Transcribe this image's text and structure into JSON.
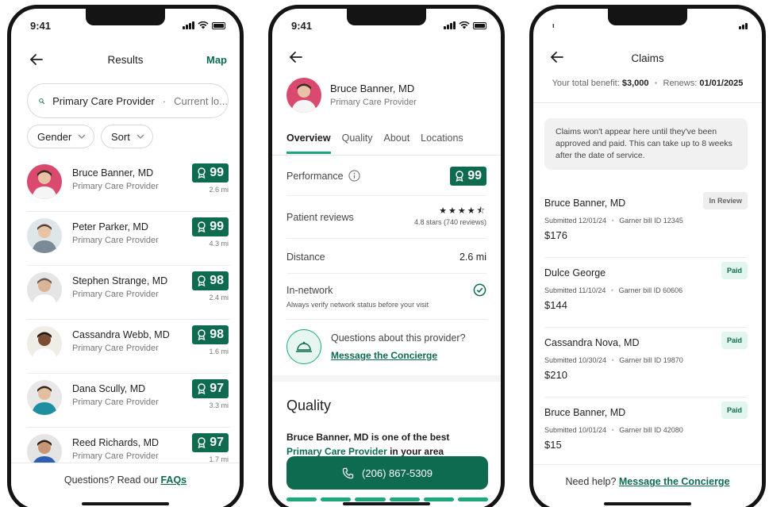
{
  "screen1": {
    "status_time": "9:41",
    "title": "Results",
    "map_label": "Map",
    "search": {
      "query": "Primary Care Provider",
      "separator": "·",
      "location": "Current lo..."
    },
    "filters": [
      {
        "label": "Gender"
      },
      {
        "label": "Sort"
      }
    ],
    "providers": [
      {
        "name": "Bruce Banner, MD",
        "specialty": "Primary Care Provider",
        "score": "99",
        "distance": "2.6 mi"
      },
      {
        "name": "Peter Parker, MD",
        "specialty": "Primary Care Provider",
        "score": "99",
        "distance": "4.3 mi"
      },
      {
        "name": "Stephen Strange, MD",
        "specialty": "Primary Care Provider",
        "score": "98",
        "distance": "2.4 mi"
      },
      {
        "name": "Cassandra Webb, MD",
        "specialty": "Primary Care Provider",
        "score": "98",
        "distance": "1.6 mi"
      },
      {
        "name": "Dana Scully, MD",
        "specialty": "Primary Care Provider",
        "score": "97",
        "distance": "3.3 mi"
      },
      {
        "name": "Reed Richards, MD",
        "specialty": "Primary Care Provider",
        "score": "97",
        "distance": "1.7 mi"
      }
    ],
    "footer_text": "Questions? Read our",
    "footer_link": "FAQs"
  },
  "screen2": {
    "status_time": "9:41",
    "name": "Bruce Banner, MD",
    "specialty": "Primary Care Provider",
    "tabs": [
      "Overview",
      "Quality",
      "About",
      "Locations"
    ],
    "performance_label": "Performance",
    "performance_score": "99",
    "reviews_label": "Patient reviews",
    "reviews_stars": "★★★★⯪",
    "reviews_text": "4.8 stars (740 reviews)",
    "distance_label": "Distance",
    "distance_value": "2.6 mi",
    "network_label": "In-network",
    "network_note": "Always verify network status before your visit",
    "concierge_question": "Questions about this provider?",
    "concierge_link": "Message the Concierge",
    "quality_title": "Quality",
    "quality_bold": "Bruce Banner, MD is one of the best",
    "quality_link": "Primary Care Provider",
    "quality_suffix": " in your area",
    "phone": "(206) 867-5309"
  },
  "screen3": {
    "title": "Claims",
    "benefit_label": "Your total benefit:",
    "benefit_amount": "$3,000",
    "renews_label": "Renews:",
    "renews_date": "01/01/2025",
    "notice": "Claims won't appear here until they've been approved and paid. This can take up to 8 weeks after the date of service.",
    "claims": [
      {
        "name": "Bruce Banner, MD",
        "submitted": "Submitted 12/01/24",
        "bill": "Garner bill ID 12345",
        "amount": "$176",
        "status": "In Review"
      },
      {
        "name": "Dulce George",
        "submitted": "Submitted 11/10/24",
        "bill": "Garner bill ID 60606",
        "amount": "$144",
        "status": "Paid"
      },
      {
        "name": "Cassandra Nova, MD",
        "submitted": "Submitted 10/30/24",
        "bill": "Garner bill ID 19870",
        "amount": "$210",
        "status": "Paid"
      },
      {
        "name": "Bruce Banner, MD",
        "submitted": "Submitted 10/01/24",
        "bill": "Garner bill ID 42080",
        "amount": "$15",
        "status": "Paid"
      }
    ],
    "footer_text": "Need help?",
    "footer_link": "Message the Concierge"
  },
  "colors": {
    "brand_green": "#0e6b4f",
    "accent_green": "#1aa87c"
  },
  "icons": [
    "back-arrow-icon",
    "search-icon",
    "chevron-down-icon",
    "award-icon",
    "info-icon",
    "check-circle-icon",
    "bell-icon",
    "phone-icon"
  ]
}
